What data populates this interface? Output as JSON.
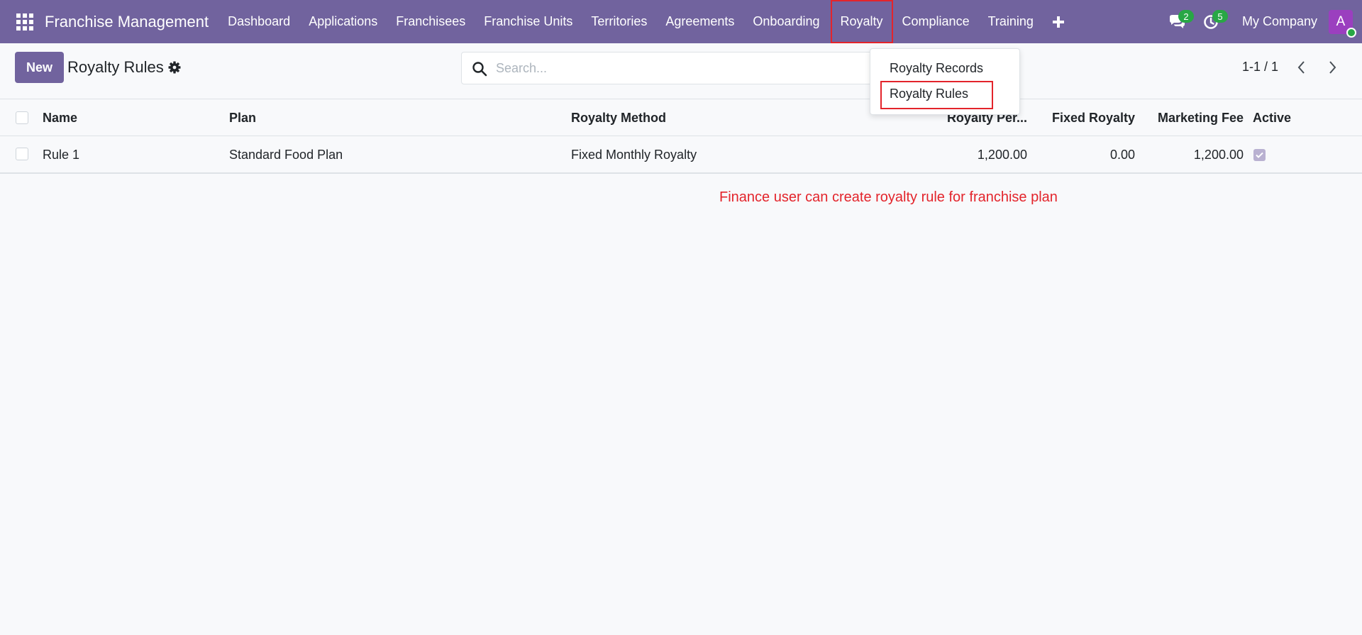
{
  "navbar": {
    "brand": "Franchise Management",
    "menu": [
      {
        "label": "Dashboard"
      },
      {
        "label": "Applications"
      },
      {
        "label": "Franchisees"
      },
      {
        "label": "Franchise Units"
      },
      {
        "label": "Territories"
      },
      {
        "label": "Agreements"
      },
      {
        "label": "Onboarding"
      },
      {
        "label": "Royalty"
      },
      {
        "label": "Compliance"
      },
      {
        "label": "Training"
      }
    ],
    "messages_count": "2",
    "activities_count": "5",
    "company": "My Company",
    "avatar_initial": "A",
    "icons": [
      "apps-grid-icon",
      "plus-icon",
      "chat-icon",
      "clock-icon"
    ]
  },
  "control_panel": {
    "new_label": "New",
    "title": "Royalty Rules",
    "search_placeholder": "Search...",
    "pager": "1-1 / 1"
  },
  "dropdown": {
    "items": [
      {
        "label": "Royalty Records"
      },
      {
        "label": "Royalty Rules"
      }
    ]
  },
  "list": {
    "columns": [
      "Name",
      "Plan",
      "Royalty Method",
      "Royalty Per...",
      "Fixed Royalty",
      "Marketing Fee",
      "Active"
    ],
    "rows": [
      {
        "name": "Rule 1",
        "plan": "Standard Food Plan",
        "method": "Fixed Monthly Royalty",
        "royalty_percent": "1,200.00",
        "fixed_royalty": "0.00",
        "marketing_fee": "1,200.00",
        "active": true
      }
    ]
  },
  "annotation": "Finance user can create royalty rule for franchise plan",
  "colors": {
    "brand": "#71639e",
    "annotation": "#e3242b",
    "badge": "#28a745"
  }
}
